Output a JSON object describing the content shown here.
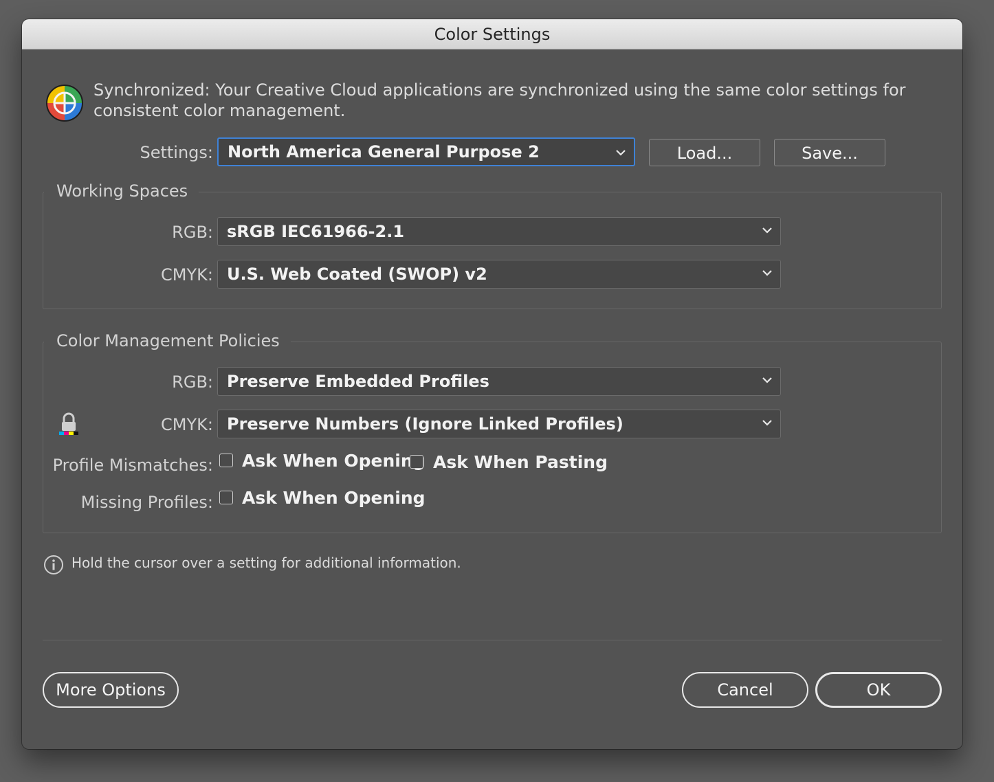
{
  "window": {
    "title": "Color Settings"
  },
  "sync": {
    "message": "Synchronized: Your Creative Cloud applications are synchronized using the same color settings for consistent color management.",
    "icon": "color-wheel-icon"
  },
  "settings": {
    "label": "Settings:",
    "value": "North America General Purpose 2",
    "load_label": "Load...",
    "save_label": "Save..."
  },
  "working_spaces": {
    "title": "Working Spaces",
    "rgb_label": "RGB:",
    "rgb_value": "sRGB IEC61966-2.1",
    "cmyk_label": "CMYK:",
    "cmyk_value": "U.S. Web Coated (SWOP) v2"
  },
  "policies": {
    "title": "Color Management Policies",
    "rgb_label": "RGB:",
    "rgb_value": "Preserve Embedded Profiles",
    "cmyk_label": "CMYK:",
    "cmyk_value": "Preserve Numbers (Ignore Linked Profiles)",
    "mismatch_label": "Profile Mismatches:",
    "mismatch_opening": "Ask When Opening",
    "mismatch_pasting": "Ask When Pasting",
    "missing_label": "Missing Profiles:",
    "missing_opening": "Ask When Opening",
    "checkboxes": {
      "mismatch_opening": false,
      "mismatch_pasting": false,
      "missing_opening": false
    }
  },
  "info": {
    "text": "Hold the cursor over a setting for additional information."
  },
  "footer": {
    "more_options": "More Options",
    "cancel": "Cancel",
    "ok": "OK"
  },
  "colors": {
    "focus": "#3f82d6",
    "dialog_bg": "#535353"
  }
}
